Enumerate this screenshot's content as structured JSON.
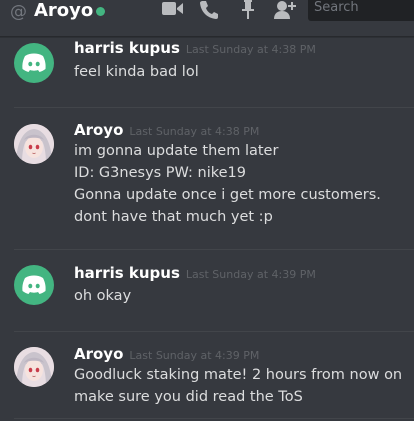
{
  "header": {
    "at_symbol": "@",
    "channel_name": "Aroyo",
    "status_color": "#43b581",
    "icons": [
      "video-icon",
      "phone-icon",
      "pin-icon",
      "add-member-icon"
    ],
    "search_placeholder": "Search"
  },
  "messages": [
    {
      "author": "harris kupus",
      "timestamp": "Last Sunday at 4:38 PM",
      "avatar": "discord-logo",
      "lines": [
        "feel kinda bad lol"
      ]
    },
    {
      "author": "Aroyo",
      "timestamp": "Last Sunday at 4:38 PM",
      "avatar": "anime-avatar",
      "lines": [
        "im gonna update them later",
        "ID: G3nesys PW: nike19",
        "Gonna update once i get more customers.",
        "dont have that much yet :p"
      ]
    },
    {
      "author": "harris kupus",
      "timestamp": "Last Sunday at 4:39 PM",
      "avatar": "discord-logo",
      "lines": [
        "oh okay"
      ]
    },
    {
      "author": "Aroyo",
      "timestamp": "Last Sunday at 4:39 PM",
      "avatar": "anime-avatar",
      "lines": [
        "Goodluck staking mate! 2 hours from now on",
        "make sure you did read the ToS"
      ]
    }
  ]
}
